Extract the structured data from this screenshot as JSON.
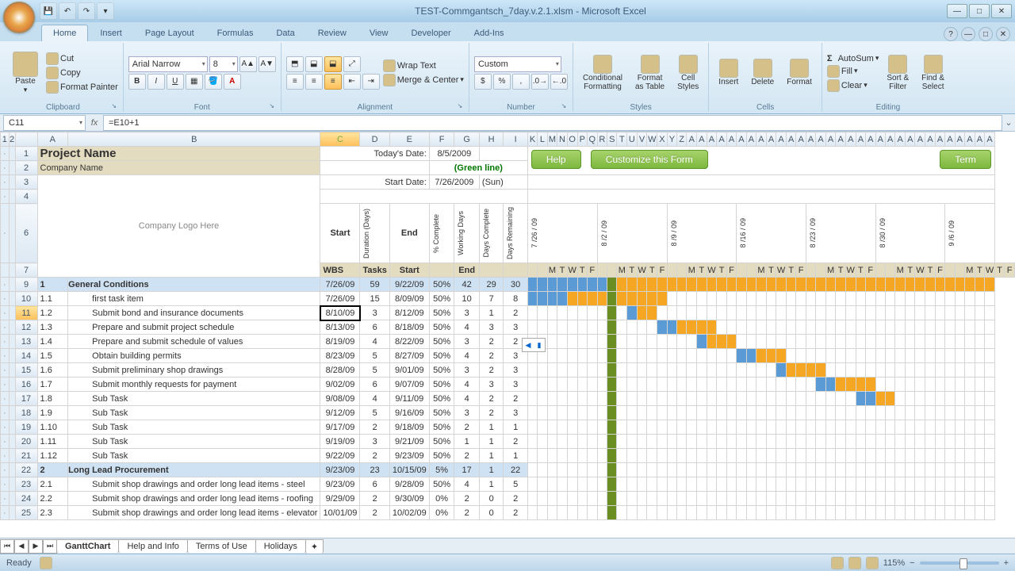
{
  "window": {
    "title": "TEST-Commgantsch_7day.v.2.1.xlsm - Microsoft Excel"
  },
  "ribbon": {
    "tabs": [
      "Home",
      "Insert",
      "Page Layout",
      "Formulas",
      "Data",
      "Review",
      "View",
      "Developer",
      "Add-Ins"
    ],
    "active": "Home",
    "groups": {
      "clipboard": "Clipboard",
      "font": "Font",
      "alignment": "Alignment",
      "number": "Number",
      "styles": "Styles",
      "cells": "Cells",
      "editing": "Editing"
    },
    "clipboard": {
      "paste": "Paste",
      "cut": "Cut",
      "copy": "Copy",
      "fp": "Format Painter"
    },
    "font": {
      "name": "Arial Narrow",
      "size": "8"
    },
    "alignment": {
      "wrap": "Wrap Text",
      "merge": "Merge & Center"
    },
    "number": {
      "format": "Custom"
    },
    "styles": {
      "cf": "Conditional\nFormatting",
      "fat": "Format\nas Table",
      "cs": "Cell\nStyles"
    },
    "cells": {
      "ins": "Insert",
      "del": "Delete",
      "fmt": "Format"
    },
    "editing": {
      "sum": "AutoSum",
      "fill": "Fill",
      "clear": "Clear",
      "sort": "Sort &\nFilter",
      "find": "Find &\nSelect"
    }
  },
  "formula": {
    "namebox": "C11",
    "value": "=E10+1"
  },
  "sheet": {
    "projectName": "Project Name",
    "companyName": "Company Name",
    "logo": "Company Logo Here",
    "todayLabel": "Today's Date:",
    "today": "8/5/2009",
    "greenline": "(Green line)",
    "startLabel": "Start Date:",
    "start": "7/26/2009",
    "sun": "(Sun)",
    "buttons": {
      "help": "Help",
      "customize": "Customize this Form",
      "term": "Term"
    },
    "cols": [
      "WBS",
      "Tasks",
      "Start",
      "Duration (Days)",
      "End",
      "% Complete",
      "Working Days",
      "Days Complete",
      "Days Remaining"
    ],
    "weeks": [
      "7 /26 / 09",
      "8 /2 / 09",
      "8 /9 / 09",
      "8 /16 / 09",
      "8 /23 / 09",
      "8 /30 / 09",
      "9 /6 / 09"
    ],
    "days": [
      "M",
      "T",
      "W",
      "T",
      "F"
    ],
    "rows": [
      {
        "r": 9,
        "wbs": "1",
        "task": "General Conditions",
        "start": "7/26/09",
        "dur": "59",
        "end": "9/22/09",
        "pct": "50%",
        "wd": "42",
        "dc": "29",
        "dr": "30",
        "section": true
      },
      {
        "r": 10,
        "wbs": "1.1",
        "task": "first task item",
        "start": "7/26/09",
        "dur": "15",
        "end": "8/09/09",
        "pct": "50%",
        "wd": "10",
        "dc": "7",
        "dr": "8",
        "bar": [
          0,
          4,
          10
        ]
      },
      {
        "r": 11,
        "wbs": "1.2",
        "task": "Submit bond and insurance documents",
        "start": "8/10/09",
        "dur": "3",
        "end": "8/12/09",
        "pct": "50%",
        "wd": "3",
        "dc": "1",
        "dr": "2",
        "bar": [
          10,
          1,
          2
        ],
        "selected": true
      },
      {
        "r": 12,
        "wbs": "1.3",
        "task": "Prepare and submit project schedule",
        "start": "8/13/09",
        "dur": "6",
        "end": "8/18/09",
        "pct": "50%",
        "wd": "4",
        "dc": "3",
        "dr": "3",
        "bar": [
          13,
          2,
          4
        ]
      },
      {
        "r": 13,
        "wbs": "1.4",
        "task": "Prepare and submit schedule of values",
        "start": "8/19/09",
        "dur": "4",
        "end": "8/22/09",
        "pct": "50%",
        "wd": "3",
        "dc": "2",
        "dr": "2",
        "bar": [
          17,
          1,
          3
        ]
      },
      {
        "r": 14,
        "wbs": "1.5",
        "task": "Obtain building permits",
        "start": "8/23/09",
        "dur": "5",
        "end": "8/27/09",
        "pct": "50%",
        "wd": "4",
        "dc": "2",
        "dr": "3",
        "bar": [
          21,
          2,
          3
        ]
      },
      {
        "r": 15,
        "wbs": "1.6",
        "task": "Submit preliminary shop drawings",
        "start": "8/28/09",
        "dur": "5",
        "end": "9/01/09",
        "pct": "50%",
        "wd": "3",
        "dc": "2",
        "dr": "3",
        "bar": [
          25,
          1,
          4
        ]
      },
      {
        "r": 16,
        "wbs": "1.7",
        "task": "Submit monthly requests for payment",
        "start": "9/02/09",
        "dur": "6",
        "end": "9/07/09",
        "pct": "50%",
        "wd": "4",
        "dc": "3",
        "dr": "3",
        "bar": [
          29,
          2,
          4
        ]
      },
      {
        "r": 17,
        "wbs": "1.8",
        "task": "Sub Task",
        "start": "9/08/09",
        "dur": "4",
        "end": "9/11/09",
        "pct": "50%",
        "wd": "4",
        "dc": "2",
        "dr": "2",
        "bar": [
          33,
          2,
          2
        ]
      },
      {
        "r": 18,
        "wbs": "1.9",
        "task": "Sub Task",
        "start": "9/12/09",
        "dur": "5",
        "end": "9/16/09",
        "pct": "50%",
        "wd": "3",
        "dc": "2",
        "dr": "3"
      },
      {
        "r": 19,
        "wbs": "1.10",
        "task": "Sub Task",
        "start": "9/17/09",
        "dur": "2",
        "end": "9/18/09",
        "pct": "50%",
        "wd": "2",
        "dc": "1",
        "dr": "1"
      },
      {
        "r": 20,
        "wbs": "1.11",
        "task": "Sub Task",
        "start": "9/19/09",
        "dur": "3",
        "end": "9/21/09",
        "pct": "50%",
        "wd": "1",
        "dc": "1",
        "dr": "2"
      },
      {
        "r": 21,
        "wbs": "1.12",
        "task": "Sub Task",
        "start": "9/22/09",
        "dur": "2",
        "end": "9/23/09",
        "pct": "50%",
        "wd": "2",
        "dc": "1",
        "dr": "1"
      },
      {
        "r": 22,
        "wbs": "2",
        "task": "Long Lead Procurement",
        "start": "9/23/09",
        "dur": "23",
        "end": "10/15/09",
        "pct": "5%",
        "wd": "17",
        "dc": "1",
        "dr": "22",
        "section": true
      },
      {
        "r": 23,
        "wbs": "2.1",
        "task": "Submit shop drawings and order long lead items - steel",
        "start": "9/23/09",
        "dur": "6",
        "end": "9/28/09",
        "pct": "50%",
        "wd": "4",
        "dc": "1",
        "dr": "5"
      },
      {
        "r": 24,
        "wbs": "2.2",
        "task": "Submit shop drawings and order long lead items - roofing",
        "start": "9/29/09",
        "dur": "2",
        "end": "9/30/09",
        "pct": "0%",
        "wd": "2",
        "dc": "0",
        "dr": "2"
      },
      {
        "r": 25,
        "wbs": "2.3",
        "task": "Submit shop drawings and order long lead items - elevator",
        "start": "10/01/09",
        "dur": "2",
        "end": "10/02/09",
        "pct": "0%",
        "wd": "2",
        "dc": "0",
        "dr": "2"
      }
    ]
  },
  "sheetTabs": [
    "GanttChart",
    "Help and Info",
    "Terms of Use",
    "Holidays"
  ],
  "status": {
    "ready": "Ready",
    "zoom": "115%"
  }
}
